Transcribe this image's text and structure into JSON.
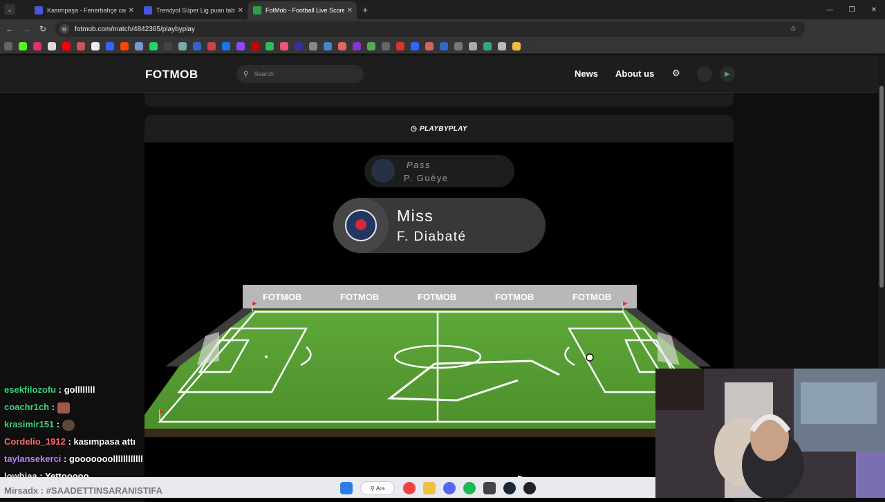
{
  "browser": {
    "tabs": [
      {
        "title": "Kasımpaşa - Fenerbahçe canlı sk",
        "active": false
      },
      {
        "title": "Trendyol Süper Lig puan tablosu",
        "active": false
      },
      {
        "title": "FotMob - Football Live Scores",
        "active": true
      }
    ],
    "url": "fotmob.com/match/4842365/playbyplay"
  },
  "header": {
    "logo": "FOTMOB",
    "search_placeholder": "Search",
    "nav_news": "News",
    "nav_about": "About us"
  },
  "playbyplay": {
    "title": "PLAYBYPLAY",
    "previous_event": {
      "action": "Pass",
      "player": "P. Guèye"
    },
    "current_event": {
      "action": "Miss",
      "player": "F. Diabaté"
    },
    "ad_board": [
      "FOTMOB",
      "FOTMOB",
      "FOTMOB",
      "FOTMOB",
      "FOTMOB"
    ]
  },
  "chat": [
    {
      "user": "esekfilozofu",
      "color": "#3fd27f",
      "message": "gollllllll"
    },
    {
      "user": "coachr1ch",
      "color": "#3fd27f",
      "message": ""
    },
    {
      "user": "krasimir151",
      "color": "#3fd27f",
      "message": ""
    },
    {
      "user": "Cordelio_1912",
      "color": "#ff6b6b",
      "message": "kasımpasa attı"
    },
    {
      "user": "taylansekerci",
      "color": "#b983ff",
      "message": "gooooooollllllllllll"
    },
    {
      "user": "lowhiaa",
      "color": "#e0e0e0",
      "message": "Yettooooo"
    },
    {
      "user": "Mirsadx",
      "color": "#333333",
      "message": "#SAADETTINSARANISTIFA"
    }
  ],
  "taskbar": {
    "search_label": "Ara"
  }
}
